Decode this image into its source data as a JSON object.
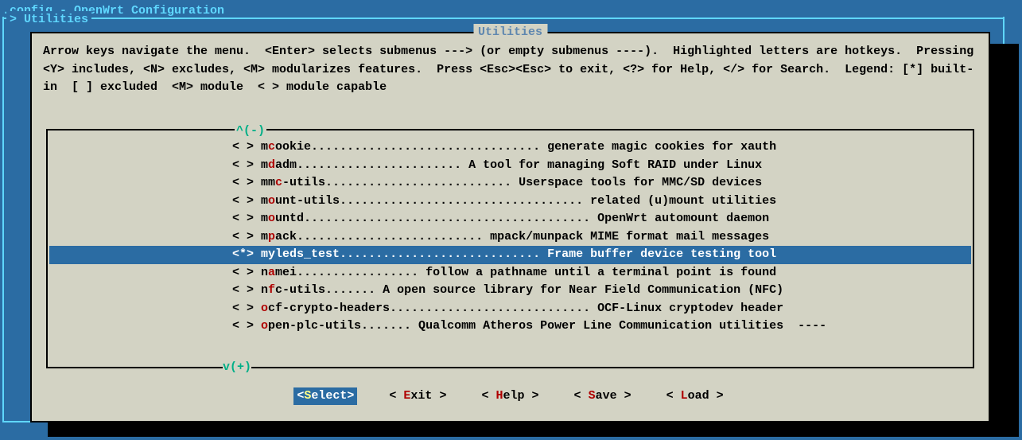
{
  "window": {
    "title": ".config - OpenWrt Configuration"
  },
  "breadcrumb": {
    "label": "> Utilities"
  },
  "panel": {
    "title": "Utilities",
    "help_text": "Arrow keys navigate the menu.  <Enter> selects submenus ---> (or empty submenus ----).  Highlighted letters are hotkeys.  Pressing <Y> includes, <N> excludes, <M> modularizes features.  Press <Esc><Esc> to exit, <?> for Help, </> for Search.  Legend: [*] built-in  [ ] excluded  <M> module  < > module capable",
    "scroll_up": "^(-)",
    "scroll_down": "v(+)"
  },
  "menu": {
    "items": [
      {
        "mark": "< >",
        "pre": "m",
        "hot": "c",
        "post": "ookie................................ generate magic cookies for xauth",
        "selected": false
      },
      {
        "mark": "< >",
        "pre": "m",
        "hot": "d",
        "post": "adm....................... A tool for managing Soft RAID under Linux",
        "selected": false
      },
      {
        "mark": "< >",
        "pre": "mm",
        "hot": "c",
        "post": "-utils.......................... Userspace tools for MMC/SD devices",
        "selected": false
      },
      {
        "mark": "< >",
        "pre": "m",
        "hot": "o",
        "post": "unt-utils.................................. related (u)mount utilities",
        "selected": false
      },
      {
        "mark": "< >",
        "pre": "m",
        "hot": "o",
        "post": "untd........................................ OpenWrt automount daemon",
        "selected": false
      },
      {
        "mark": "< >",
        "pre": "m",
        "hot": "p",
        "post": "ack.......................... mpack/munpack MIME format mail messages",
        "selected": false
      },
      {
        "mark": "<*>",
        "pre": "myl",
        "hot": "e",
        "post": "ds_test............................ Frame buffer device testing tool",
        "selected": true
      },
      {
        "mark": "< >",
        "pre": "n",
        "hot": "a",
        "post": "mei................. follow a pathname until a terminal point is found",
        "selected": false
      },
      {
        "mark": "< >",
        "pre": "n",
        "hot": "f",
        "post": "c-utils....... A open source library for Near Field Communication (NFC)",
        "selected": false
      },
      {
        "mark": "< >",
        "pre": "",
        "hot": "o",
        "post": "cf-crypto-headers............................ OCF-Linux cryptodev header",
        "selected": false
      },
      {
        "mark": "< >",
        "pre": "",
        "hot": "o",
        "post": "pen-plc-utils....... Qualcomm Atheros Power Line Communication utilities  ----",
        "selected": false
      }
    ]
  },
  "buttons": {
    "items": [
      {
        "open": "<",
        "letter": "S",
        "rest": "elect",
        "close": ">",
        "selected": true
      },
      {
        "open": "< ",
        "letter": "E",
        "rest": "xit",
        "close": " >",
        "selected": false
      },
      {
        "open": "< ",
        "letter": "H",
        "rest": "elp",
        "close": " >",
        "selected": false
      },
      {
        "open": "< ",
        "letter": "S",
        "rest": "ave",
        "close": " >",
        "selected": false
      },
      {
        "open": "< ",
        "letter": "L",
        "rest": "oad",
        "close": " >",
        "selected": false
      }
    ]
  }
}
